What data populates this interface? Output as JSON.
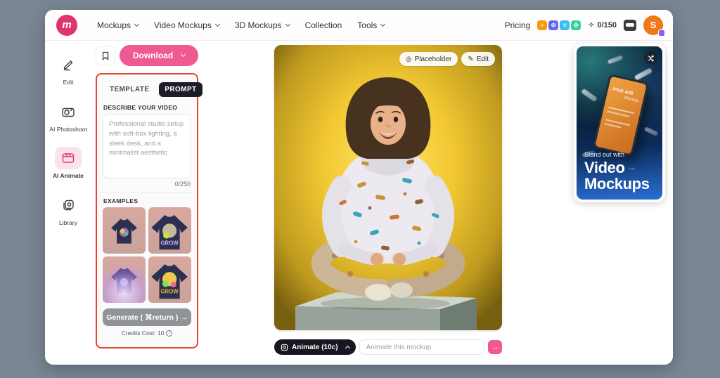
{
  "header": {
    "logo_letter": "m",
    "nav": [
      {
        "label": "Mockups",
        "dropdown": true
      },
      {
        "label": "Video Mockups",
        "dropdown": true
      },
      {
        "label": "3D Mockups",
        "dropdown": true
      },
      {
        "label": "Collection",
        "dropdown": false
      },
      {
        "label": "Tools",
        "dropdown": true
      }
    ],
    "pricing_label": "Pricing",
    "badges": [
      {
        "icon": "plus-badge",
        "glyph": "+",
        "color": "#F59E0B"
      },
      {
        "icon": "snowflake-badge",
        "glyph": "❆",
        "color": "#6366F1"
      },
      {
        "icon": "burst-badge",
        "glyph": "✳",
        "color": "#38BDF8"
      },
      {
        "icon": "clover-badge",
        "glyph": "✤",
        "color": "#34D399"
      }
    ],
    "credits_counter": "0/150",
    "sparkle_glyph": "✧",
    "avatar_initial": "S"
  },
  "sidebar": {
    "items": [
      {
        "label": "Edit",
        "icon": "pencil-icon",
        "active": false
      },
      {
        "label": "AI Photoshoot",
        "icon": "camera-icon",
        "active": false
      },
      {
        "label": "AI Animate",
        "icon": "clapperboard-icon",
        "active": true
      },
      {
        "label": "Library",
        "icon": "library-icon",
        "active": false
      }
    ]
  },
  "left_panel": {
    "download_label": "Download",
    "tabs": [
      {
        "label": "TEMPLATE",
        "active": false
      },
      {
        "label": "PROMPT",
        "active": true
      }
    ],
    "describe_label": "DESCRIBE YOUR VIDEO",
    "prompt_placeholder": "Professional studio setup with soft-box lighting, a sleek desk, and a minimalist aesthetic",
    "char_counter": "0/250",
    "examples_label": "EXAMPLES",
    "example_thumbnails": [
      {
        "name": "tshirt-front-navy"
      },
      {
        "name": "tshirt-back-grow",
        "shirt_text": "GROW"
      },
      {
        "name": "tshirt-front-glow"
      },
      {
        "name": "tshirt-back-bright",
        "shirt_text": "GROW"
      }
    ],
    "generate_label": "Generate ( ⌘return ) →",
    "credits_cost_label": "Credits Cost: 10",
    "info_glyph": "i"
  },
  "canvas": {
    "placeholder_button": "Placeholder",
    "placeholder_icon_glyph": "◎",
    "edit_button": "Edit",
    "edit_icon_glyph": "✎",
    "animate_button": "Animate (10c)",
    "animate_input_placeholder": "Animate this mockup",
    "send_glyph": "→",
    "image_description": "Smiling child in dinosaur-print hoodie sitting cross-legged on gray cube, yellow studio background"
  },
  "promo": {
    "tagline": "Stand out with",
    "title_line1": "Video",
    "title_line2": "Mockups",
    "arrow_glyph": "→",
    "phone_title": "iPAD AIR",
    "phone_subtitle": "Mockup"
  },
  "colors": {
    "accent_pink": "#EF5A93",
    "logo_pink": "#E0346E",
    "highlight_red": "#E8432E",
    "dark_pill": "#1B1B26",
    "promo_blue": "#2A6FD6",
    "avatar_orange": "#F07818",
    "outer_background": "#7A8694",
    "preview_yellow": "#F2C832"
  }
}
